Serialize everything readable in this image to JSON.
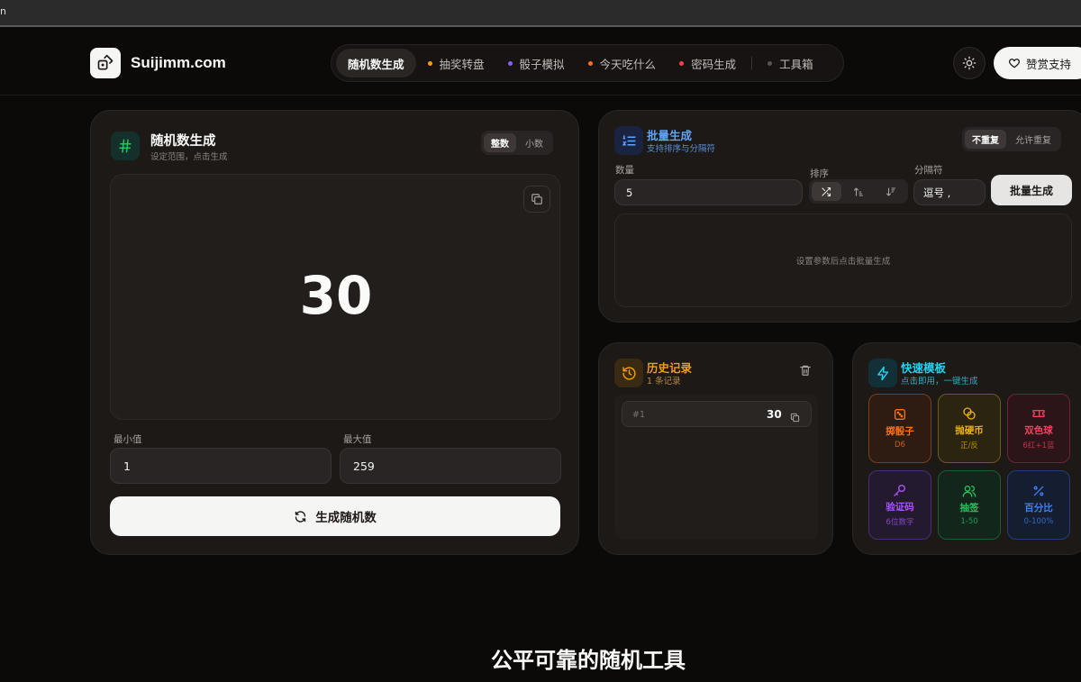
{
  "browser": {
    "fragment": "n"
  },
  "header": {
    "brand": "Suijimm.com",
    "nav": [
      {
        "label": "随机数生成",
        "active": true,
        "dot": ""
      },
      {
        "label": "抽奖转盘",
        "dot": "#f59e0b"
      },
      {
        "label": "骰子模拟",
        "dot": "#8b5cf6"
      },
      {
        "label": "今天吃什么",
        "dot": "#f97316"
      },
      {
        "label": "密码生成",
        "dot": "#ef4444"
      },
      {
        "label": "工具箱",
        "dot": "#57534e"
      }
    ],
    "theme_icon": "sun-icon",
    "support_label": "赞赏支持"
  },
  "random_card": {
    "title": "随机数生成",
    "subtitle": "设定范围，点击生成",
    "mode_options": [
      "整数",
      "小数"
    ],
    "mode_selected": "整数",
    "result": "30",
    "min_label": "最小值",
    "min_value": "1",
    "max_label": "最大值",
    "max_value": "259",
    "generate_label": "生成随机数"
  },
  "batch_card": {
    "title": "批量生成",
    "subtitle": "支持排序与分隔符",
    "repeat_options": [
      "不重复",
      "允许重复"
    ],
    "repeat_selected": "不重复",
    "count_label": "数量",
    "count_value": "5",
    "sort_label": "排序",
    "sort_options": [
      "shuffle-icon",
      "sort-ascending-icon",
      "sort-descending-icon"
    ],
    "separator_label": "分隔符",
    "separator_value": "逗号 ,",
    "batch_button": "批量生成",
    "empty_text": "设置参数后点击批量生成"
  },
  "history_card": {
    "title": "历史记录",
    "subtitle": "1 条记录",
    "items": [
      {
        "index": "#1",
        "value": "30"
      }
    ]
  },
  "templates_card": {
    "title": "快速模板",
    "subtitle": "点击即用，一键生成",
    "items": [
      {
        "title": "掷骰子",
        "sub": "D6",
        "icon": "dice-icon",
        "color": "#f97316"
      },
      {
        "title": "抛硬币",
        "sub": "正/反",
        "icon": "coins-icon",
        "color": "#eab308"
      },
      {
        "title": "双色球",
        "sub": "6红+1蓝",
        "icon": "ticket-icon",
        "color": "#f43f5e"
      },
      {
        "title": "验证码",
        "sub": "6位数字",
        "icon": "key-icon",
        "color": "#a855f7"
      },
      {
        "title": "抽签",
        "sub": "1-50",
        "icon": "users-icon",
        "color": "#22c55e"
      },
      {
        "title": "百分比",
        "sub": "0-100%",
        "icon": "percent-icon",
        "color": "#3b82f6"
      }
    ]
  },
  "tagline": "公平可靠的随机工具",
  "colors": {
    "background": "#0c0a09",
    "card": "#1c1917",
    "accent_green": "#22c55e",
    "accent_blue": "#60a5fa",
    "accent_amber": "#f59e0b",
    "accent_cyan": "#22d3ee"
  }
}
